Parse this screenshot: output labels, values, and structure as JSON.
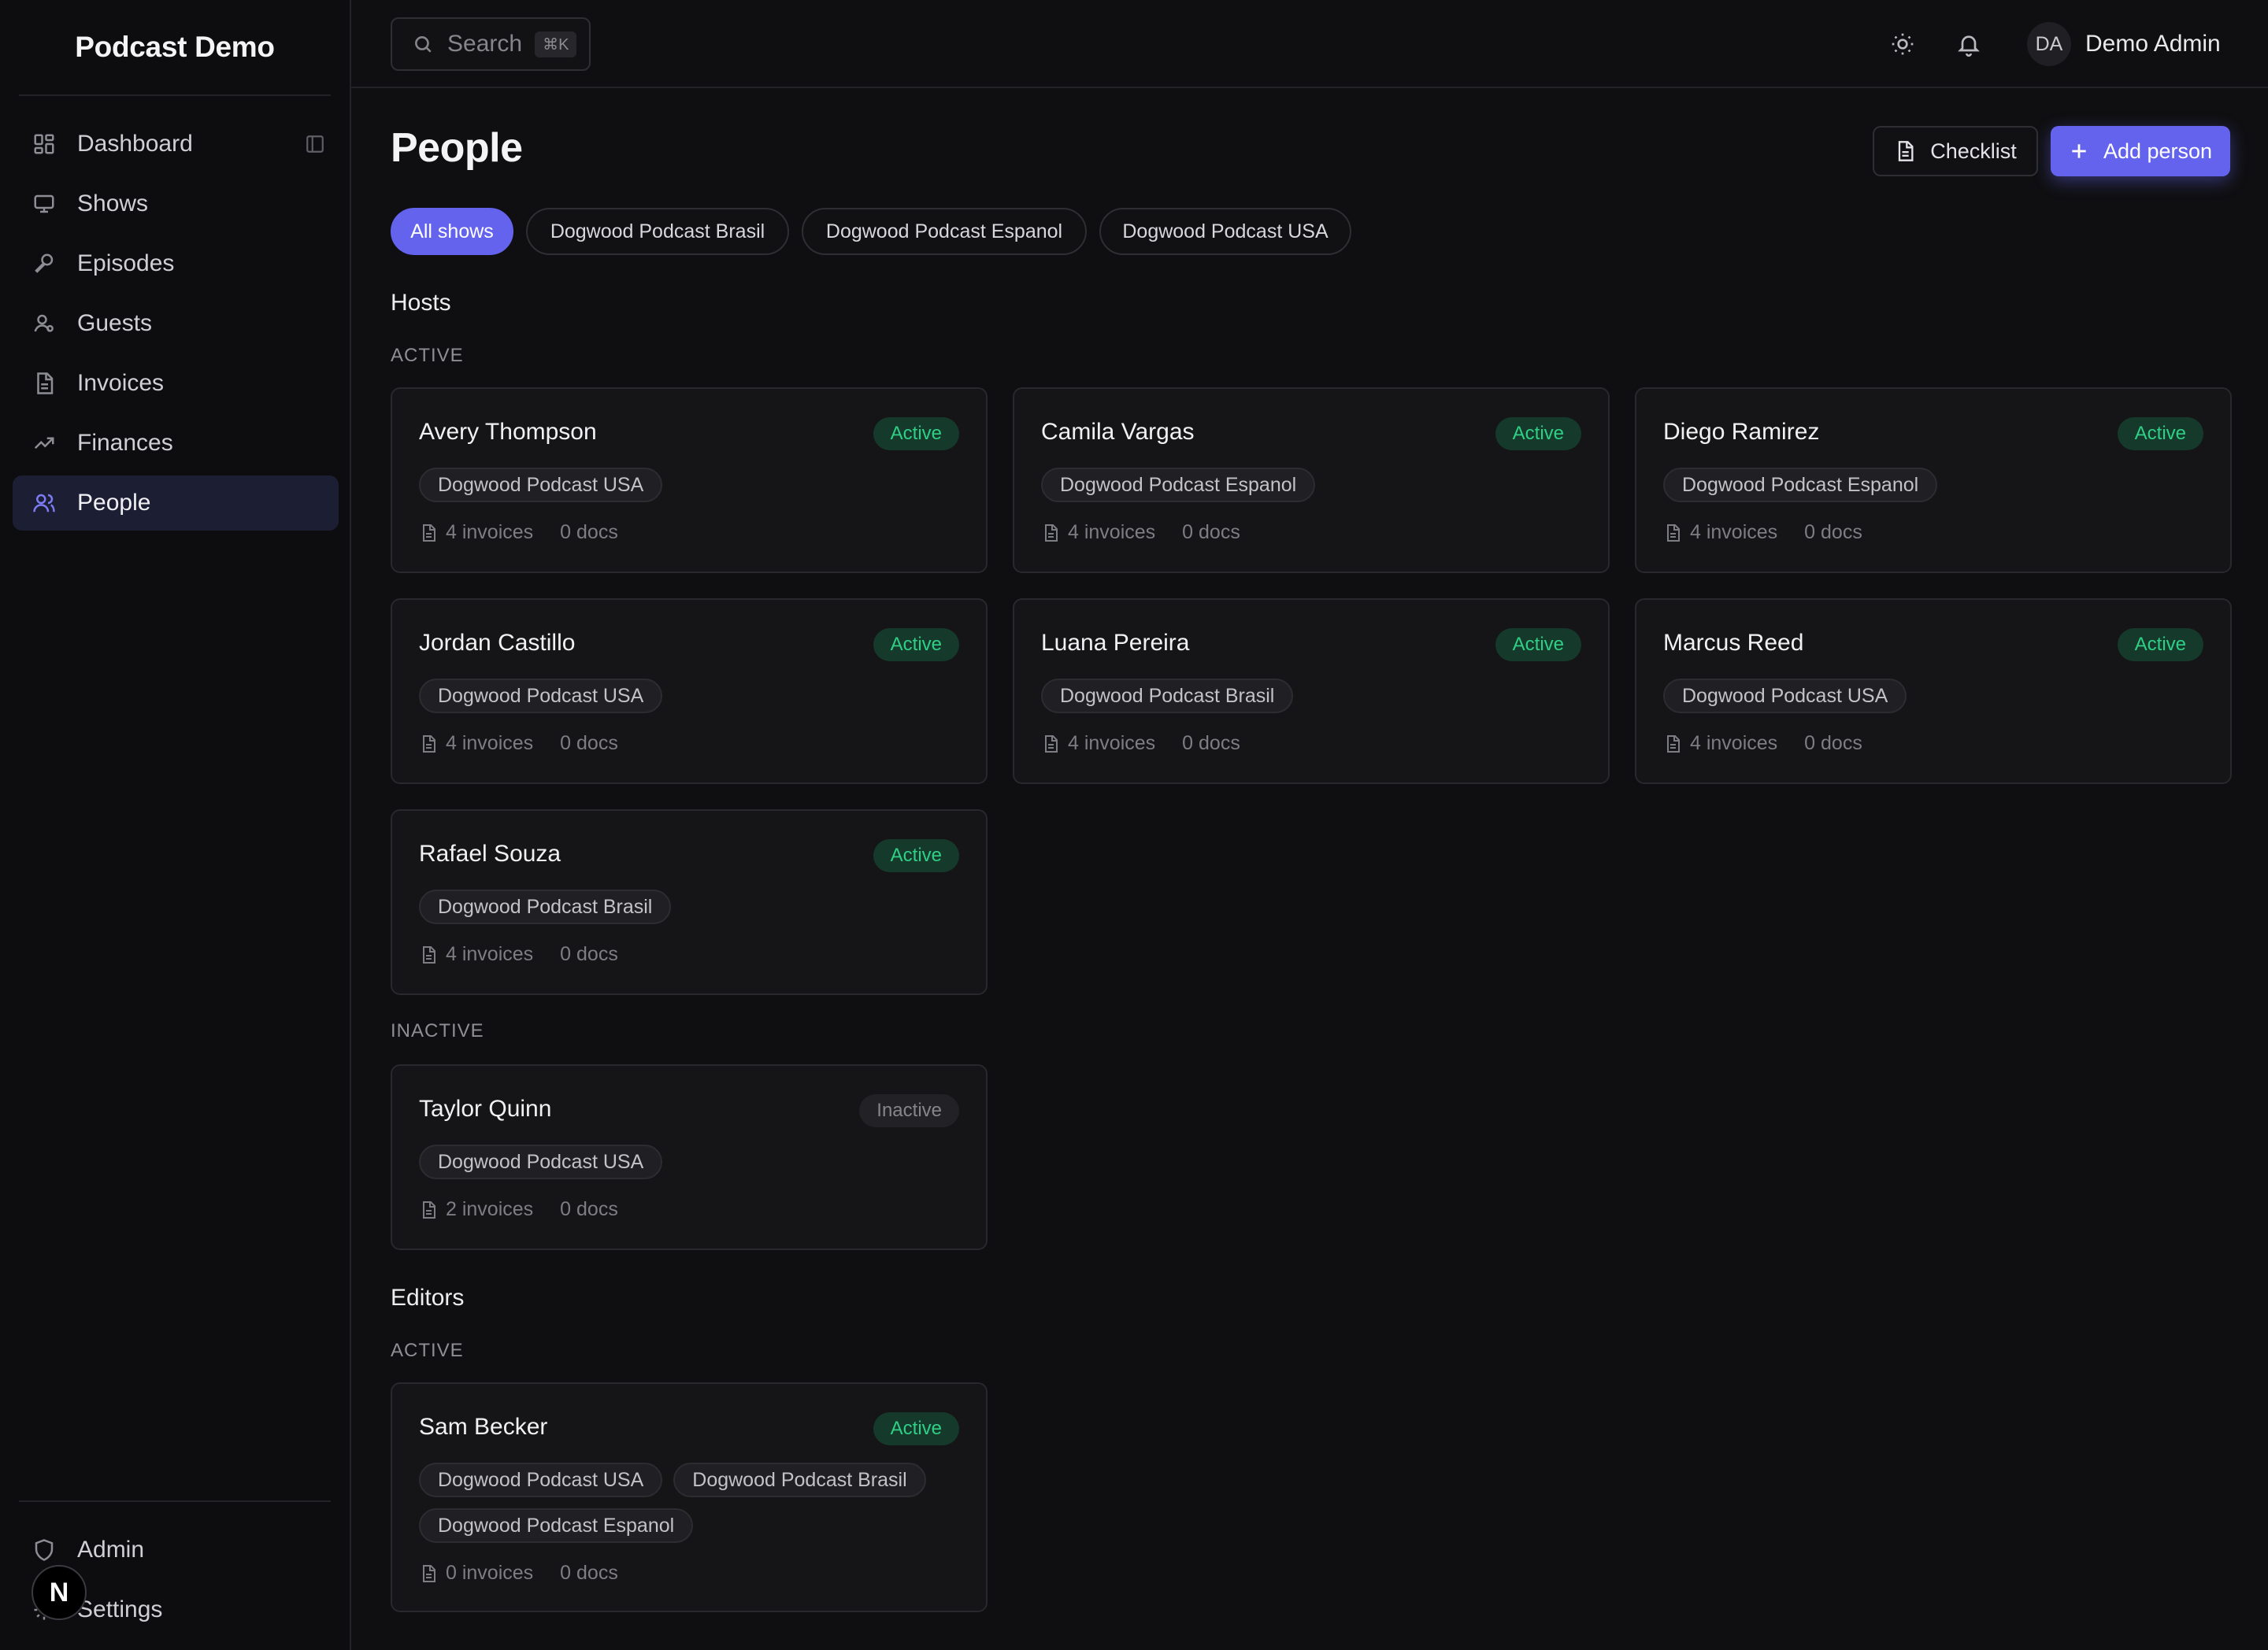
{
  "app": {
    "title": "Podcast Demo",
    "badge": "N"
  },
  "sidebar": {
    "items": [
      {
        "label": "Dashboard",
        "icon": "dashboard-icon"
      },
      {
        "label": "Shows",
        "icon": "monitor-icon"
      },
      {
        "label": "Episodes",
        "icon": "microphone-icon"
      },
      {
        "label": "Guests",
        "icon": "user-icon"
      },
      {
        "label": "Invoices",
        "icon": "file-icon"
      },
      {
        "label": "Finances",
        "icon": "trending-up-icon"
      },
      {
        "label": "People",
        "icon": "users-icon",
        "active": true
      }
    ],
    "footer": [
      {
        "label": "Admin",
        "icon": "shield-icon"
      },
      {
        "label": "Settings",
        "icon": "gear-icon"
      }
    ]
  },
  "topbar": {
    "search_placeholder": "Search",
    "search_shortcut": "⌘K",
    "user_initials": "DA",
    "user_name": "Demo Admin"
  },
  "page": {
    "title": "People",
    "checklist_label": "Checklist",
    "add_label": "Add person",
    "filters": [
      {
        "label": "All shows",
        "active": true
      },
      {
        "label": "Dogwood Podcast Brasil"
      },
      {
        "label": "Dogwood Podcast Espanol"
      },
      {
        "label": "Dogwood Podcast USA"
      }
    ]
  },
  "sections": {
    "hosts": {
      "title": "Hosts",
      "active_label": "ACTIVE",
      "inactive_label": "INACTIVE",
      "active": [
        {
          "name": "Avery Thompson",
          "status": "Active",
          "tags": [
            "Dogwood Podcast USA"
          ],
          "invoices": "4 invoices",
          "docs": "0 docs"
        },
        {
          "name": "Camila Vargas",
          "status": "Active",
          "tags": [
            "Dogwood Podcast Espanol"
          ],
          "invoices": "4 invoices",
          "docs": "0 docs"
        },
        {
          "name": "Diego Ramirez",
          "status": "Active",
          "tags": [
            "Dogwood Podcast Espanol"
          ],
          "invoices": "4 invoices",
          "docs": "0 docs"
        },
        {
          "name": "Jordan Castillo",
          "status": "Active",
          "tags": [
            "Dogwood Podcast USA"
          ],
          "invoices": "4 invoices",
          "docs": "0 docs"
        },
        {
          "name": "Luana Pereira",
          "status": "Active",
          "tags": [
            "Dogwood Podcast Brasil"
          ],
          "invoices": "4 invoices",
          "docs": "0 docs"
        },
        {
          "name": "Marcus Reed",
          "status": "Active",
          "tags": [
            "Dogwood Podcast USA"
          ],
          "invoices": "4 invoices",
          "docs": "0 docs"
        },
        {
          "name": "Rafael Souza",
          "status": "Active",
          "tags": [
            "Dogwood Podcast Brasil"
          ],
          "invoices": "4 invoices",
          "docs": "0 docs"
        }
      ],
      "inactive": [
        {
          "name": "Taylor Quinn",
          "status": "Inactive",
          "tags": [
            "Dogwood Podcast USA"
          ],
          "invoices": "2 invoices",
          "docs": "0 docs"
        }
      ]
    },
    "editors": {
      "title": "Editors",
      "active_label": "ACTIVE",
      "active": [
        {
          "name": "Sam Becker",
          "status": "Active",
          "tags": [
            "Dogwood Podcast USA",
            "Dogwood Podcast Brasil",
            "Dogwood Podcast Espanol"
          ],
          "invoices": "0 invoices",
          "docs": "0 docs"
        }
      ]
    }
  },
  "colors": {
    "accent": "#6363ee",
    "active_green": "#2fcf86",
    "background": "#0f0f11"
  }
}
